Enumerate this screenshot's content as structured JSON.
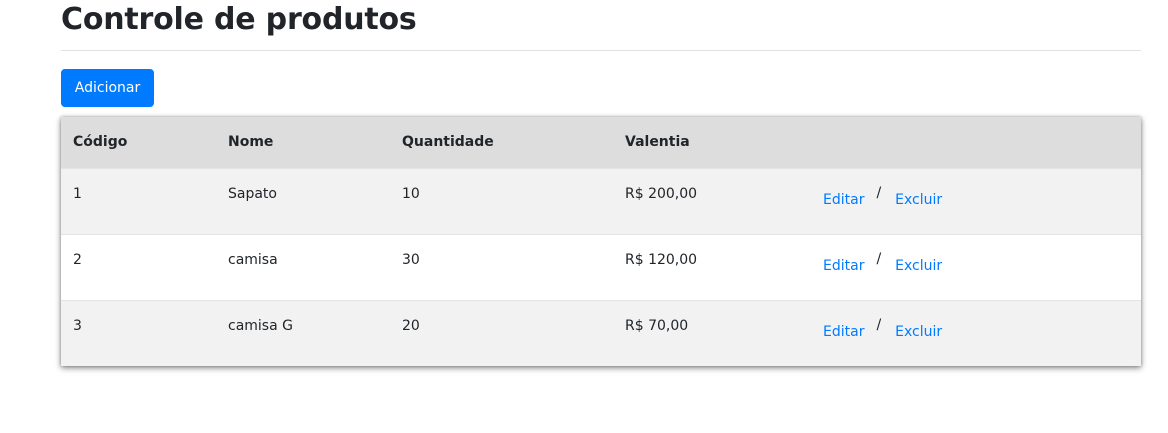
{
  "page": {
    "title": "Controle de produtos",
    "add_button_label": "Adicionar"
  },
  "table": {
    "headers": [
      "Código",
      "Nome",
      "Quantidade",
      "Valentia",
      ""
    ],
    "rows": [
      {
        "codigo": "1",
        "nome": "Sapato",
        "quantidade": "10",
        "valor": "R$ 200,00",
        "edit_label": "Editar",
        "separator": "/",
        "delete_label": "Excluir"
      },
      {
        "codigo": "2",
        "nome": "camisa",
        "quantidade": "30",
        "valor": "R$ 120,00",
        "edit_label": "Editar",
        "separator": "/",
        "delete_label": "Excluir"
      },
      {
        "codigo": "3",
        "nome": "camisa G",
        "quantidade": "20",
        "valor": "R$ 70,00",
        "edit_label": "Editar",
        "separator": "/",
        "delete_label": "Excluir"
      }
    ]
  },
  "colors": {
    "primary": "#007bff",
    "header_bg": "#dddddd",
    "row_odd_bg": "#f2f2f2",
    "row_even_bg": "#ffffff"
  }
}
